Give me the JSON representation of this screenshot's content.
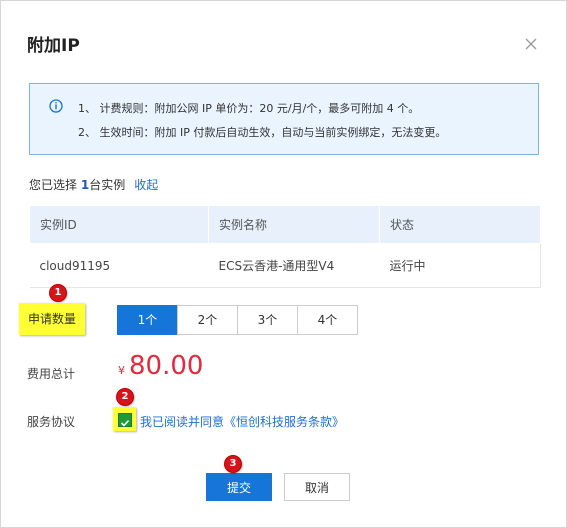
{
  "dialog": {
    "title": "附加IP"
  },
  "notice": {
    "line1": "1、 计费规则：附加公网 IP 单价为：20 元/月/个，最多可附加 4 个。",
    "line2": "2、 生效时间：附加 IP 付款后自动生效，自动与当前实例绑定，无法变更。"
  },
  "selection": {
    "prefix": "您已选择 ",
    "count": "1",
    "suffix": "台实例",
    "collapse": "收起"
  },
  "table": {
    "headers": [
      "实例ID",
      "实例名称",
      "状态"
    ],
    "rows": [
      {
        "id": "cloud91195",
        "name": "ECS云香港-通用型V4",
        "status": "运行中"
      }
    ]
  },
  "quantity": {
    "label": "申请数量",
    "options": [
      "1个",
      "2个",
      "3个",
      "4个"
    ],
    "selected": "1个"
  },
  "fee": {
    "label": "费用总计",
    "currency": "¥",
    "amount": "80.00"
  },
  "agreement": {
    "label": "服务协议",
    "checked": true,
    "text": "我已阅读并同意",
    "link": "《恒创科技服务条款》"
  },
  "buttons": {
    "submit": "提交",
    "cancel": "取消"
  },
  "markers": [
    "1",
    "2",
    "3"
  ],
  "colors": {
    "primary": "#1675d9",
    "price": "#e8283c",
    "running": "#2aaa4b",
    "highlight": "#ffff33",
    "marker": "#d8141a"
  }
}
